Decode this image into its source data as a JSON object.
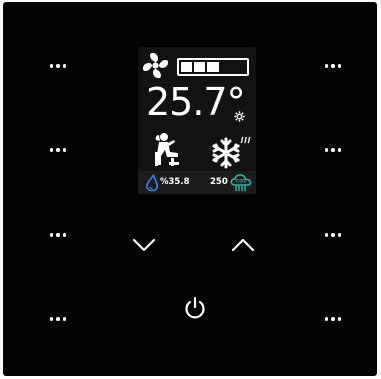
{
  "thermostat": {
    "temperature": "25.7°",
    "fan_level": 3,
    "fan_level_max": 5,
    "mode": "cooling",
    "presence": "occupied-relaxing",
    "humidity_text": "%35.8",
    "co2_value": "250",
    "co2_icon_label": "CO2"
  },
  "buttons": {
    "left": [
      "more-options",
      "more-options",
      "more-options",
      "more-options"
    ],
    "right": [
      "more-options",
      "more-options",
      "more-options",
      "more-options"
    ],
    "down_icon": "chevron-down-icon",
    "up_icon": "chevron-up-icon",
    "power_icon": "power-icon"
  },
  "colors": {
    "panel": "#030303",
    "screen": "#121212",
    "text": "#ffffff",
    "humidity_icon": "#3a7ee0",
    "co2_icon": "#2fb3a4"
  }
}
